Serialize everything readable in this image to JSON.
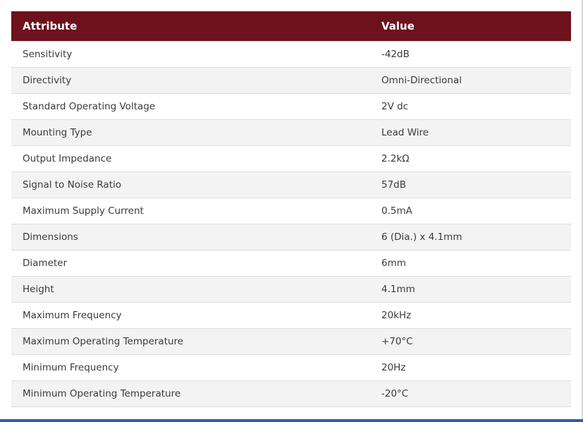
{
  "table": {
    "headers": {
      "attribute": "Attribute",
      "value": "Value"
    },
    "rows": [
      {
        "attribute": "Sensitivity",
        "value": "-42dB"
      },
      {
        "attribute": "Directivity",
        "value": "Omni-Directional"
      },
      {
        "attribute": "Standard Operating Voltage",
        "value": "2V dc"
      },
      {
        "attribute": "Mounting Type",
        "value": "Lead Wire"
      },
      {
        "attribute": "Output Impedance",
        "value": "2.2kΩ"
      },
      {
        "attribute": "Signal to Noise Ratio",
        "value": "57dB"
      },
      {
        "attribute": "Maximum Supply Current",
        "value": "0.5mA"
      },
      {
        "attribute": "Dimensions",
        "value": "6 (Dia.) x 4.1mm"
      },
      {
        "attribute": "Diameter",
        "value": "6mm"
      },
      {
        "attribute": "Height",
        "value": "4.1mm"
      },
      {
        "attribute": "Maximum Frequency",
        "value": "20kHz"
      },
      {
        "attribute": "Maximum Operating Temperature",
        "value": "+70°C"
      },
      {
        "attribute": "Minimum Frequency",
        "value": "20Hz"
      },
      {
        "attribute": "Minimum Operating Temperature",
        "value": "-20°C"
      }
    ]
  },
  "colors": {
    "header_background": "#6d121d",
    "header_text": "#ffffff",
    "stripe_row": "#f3f3f3",
    "bottom_accent": "#2d5ea8"
  }
}
